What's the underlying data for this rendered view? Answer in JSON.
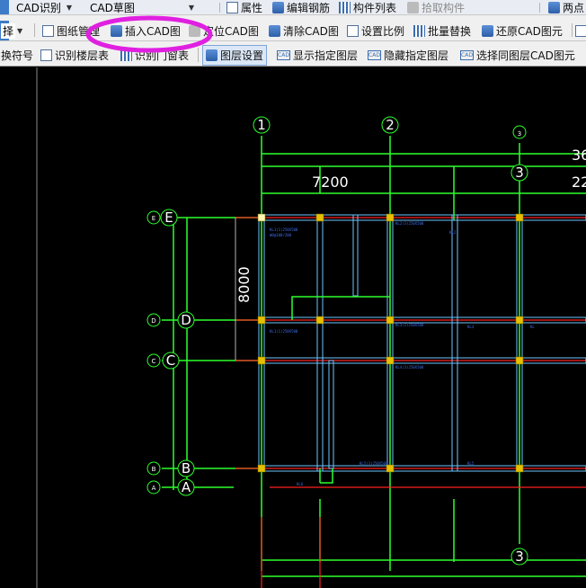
{
  "toolbar1": {
    "dropdown1": "CAD识别",
    "dropdown2": "CAD草图",
    "properties": "属性",
    "edit_rebar": "编辑钢筋",
    "component_list": "构件列表",
    "pick_component": "拾取构件",
    "two_points": "两点"
  },
  "toolbar2": {
    "select_fragment": "择",
    "drawing_manage": "图纸管理",
    "insert_cad": "插入CAD图",
    "locate_cad": "定位CAD图",
    "clear_cad": "清除CAD图",
    "set_scale": "设置比例",
    "batch_replace": "批量替换",
    "restore_cad": "还原CAD图元"
  },
  "toolbar3": {
    "replace_symbol": "换符号",
    "identify_floor_table": "识别楼层表",
    "identify_other": "识别门窗表",
    "layer_settings": "图层设置",
    "show_layer": "显示指定图层",
    "hide_layer": "隐藏指定图层",
    "select_same_layer": "选择同图层CAD图元"
  },
  "drawing": {
    "col_labels": [
      "1",
      "2",
      "3",
      "3",
      "3"
    ],
    "row_labels": [
      "E",
      "D",
      "C",
      "B",
      "A"
    ],
    "dim_top": "7200",
    "dim_left": "8000",
    "dim_right1": "36",
    "dim_right2": "22"
  },
  "colors": {
    "grid_green": "#2dff2d",
    "beam_red": "#ff2020",
    "column_yellow": "#e6c000",
    "wall_cyan": "#6ec6ff",
    "highlight_magenta": "#e020e0"
  }
}
